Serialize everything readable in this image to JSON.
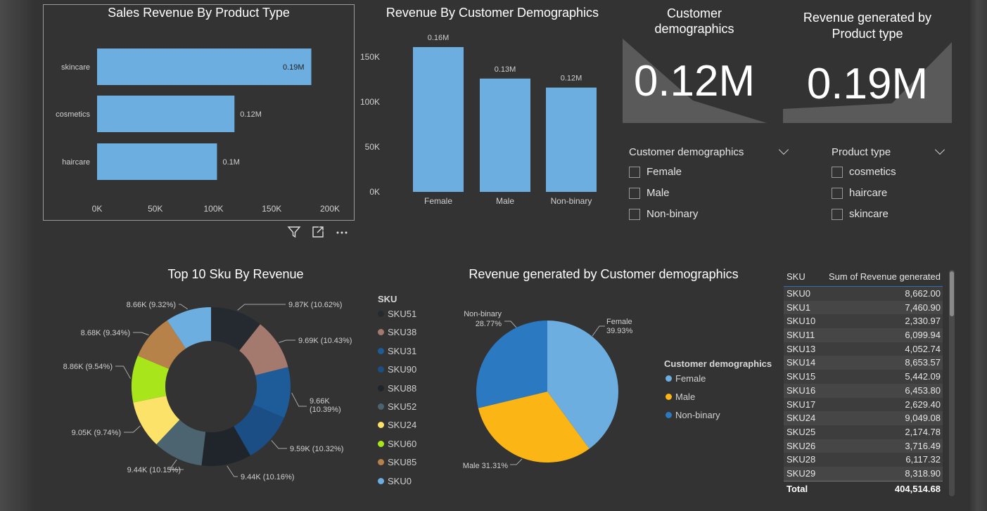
{
  "bar_h": {
    "title": "Sales Revenue By Product Type",
    "categories": [
      "skincare",
      "cosmetics",
      "haircare"
    ],
    "values": [
      184000,
      118000,
      103000
    ],
    "labels": [
      "0.19M",
      "0.12M",
      "0.1M"
    ],
    "ticks": [
      "0K",
      "50K",
      "100K",
      "150K",
      "200K"
    ],
    "color": "#6caee0"
  },
  "bar_v": {
    "title": "Revenue By Customer Demographics",
    "categories": [
      "Female",
      "Male",
      "Non-binary"
    ],
    "values": [
      161000,
      126000,
      116000
    ],
    "labels": [
      "0.16M",
      "0.13M",
      "0.12M"
    ],
    "ticks": [
      "0K",
      "50K",
      "100K",
      "150K"
    ],
    "color": "#6caee0"
  },
  "card1": {
    "title_line1": "Customer",
    "title_line2": "demographics",
    "value": "0.12M"
  },
  "card2": {
    "title_line1": "Revenue generated by",
    "title_line2": "Product type",
    "value": "0.19M"
  },
  "slicer1": {
    "title": "Customer demographics",
    "options": [
      "Female",
      "Male",
      "Non-binary"
    ]
  },
  "slicer2": {
    "title": "Product type",
    "options": [
      "cosmetics",
      "haircare",
      "skincare"
    ]
  },
  "donut": {
    "title": "Top 10 Sku By Revenue",
    "legend_title": "SKU",
    "slices": [
      {
        "name": "SKU51",
        "label": "9.87K (10.62%)",
        "value": 9866,
        "color": "#252a31"
      },
      {
        "name": "SKU38",
        "label": "9.69K (10.43%)",
        "value": 9692,
        "color": "#a47a6e"
      },
      {
        "name": "SKU31",
        "label": "9.66K (10.39%)",
        "value": 9656,
        "color": "#1e5c99"
      },
      {
        "name": "SKU90",
        "label": "9.59K (10.32%)",
        "value": 9592,
        "color": "#1a4e85"
      },
      {
        "name": "SKU88",
        "label": "9.44K (10.16%)",
        "value": 9444,
        "color": "#20242b"
      },
      {
        "name": "SKU52",
        "label": "9.44K (10.15%)",
        "value": 9435,
        "color": "#4b6470"
      },
      {
        "name": "SKU24",
        "label": "9.05K (9.74%)",
        "value": 9049,
        "color": "#fde26a"
      },
      {
        "name": "SKU60",
        "label": "8.86K (9.54%)",
        "value": 8865,
        "color": "#a8e61b"
      },
      {
        "name": "SKU85",
        "label": "8.68K (9.34%)",
        "value": 8684,
        "color": "#b6824a"
      },
      {
        "name": "SKU0",
        "label": "8.66K (9.32%)",
        "value": 8662,
        "color": "#6caee0"
      }
    ]
  },
  "pie": {
    "title": "Revenue generated by Customer demographics",
    "legend_title": "Customer demographics",
    "slices": [
      {
        "name": "Female",
        "pct": "39.93%",
        "value": 39.93,
        "color": "#6caee0"
      },
      {
        "name": "Male",
        "pct": "31.31%",
        "value": 31.31,
        "color": "#fbb515"
      },
      {
        "name": "Non-binary",
        "pct": "28.77%",
        "value": 28.77,
        "color": "#2a79c1"
      }
    ],
    "label_male": "Male 31.31%"
  },
  "table": {
    "col1": "SKU",
    "col2": "Sum of Revenue generated",
    "rows": [
      [
        "SKU0",
        "8,662.00"
      ],
      [
        "SKU1",
        "7,460.90"
      ],
      [
        "SKU10",
        "2,330.97"
      ],
      [
        "SKU11",
        "6,099.94"
      ],
      [
        "SKU13",
        "4,052.74"
      ],
      [
        "SKU14",
        "8,653.57"
      ],
      [
        "SKU15",
        "5,442.09"
      ],
      [
        "SKU16",
        "6,453.80"
      ],
      [
        "SKU17",
        "2,629.40"
      ],
      [
        "SKU24",
        "9,049.08"
      ],
      [
        "SKU25",
        "2,174.78"
      ],
      [
        "SKU26",
        "3,716.49"
      ],
      [
        "SKU28",
        "6,117.32"
      ],
      [
        "SKU29",
        "8,318.90"
      ]
    ],
    "total_label": "Total",
    "total_value": "404,514.68"
  },
  "icons": [
    "filter-icon",
    "focus-mode-icon",
    "more-options-icon"
  ]
}
